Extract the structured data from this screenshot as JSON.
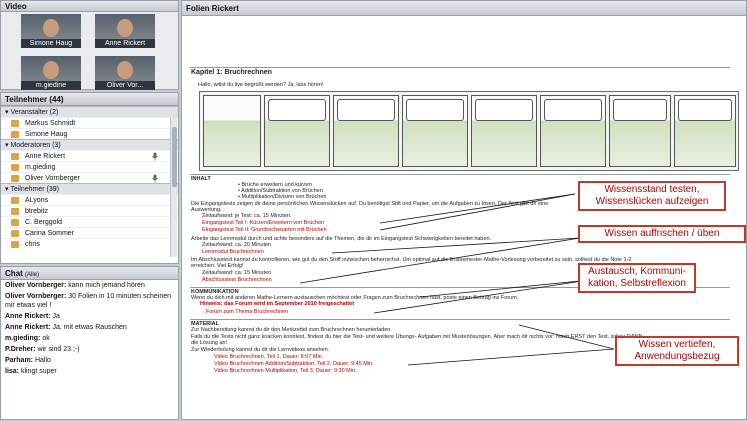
{
  "video": {
    "title": "Video",
    "tiles": [
      "Simone Haug",
      "Anne Rickert",
      "m.giedine",
      "Oliver Vor..."
    ]
  },
  "participants": {
    "title": "Teilnehmer",
    "count": "(44)",
    "groups": [
      {
        "label": "▾ Veranstalter (2)",
        "users": [
          "Markus Schmidt",
          "Simone Haug"
        ]
      },
      {
        "label": "▾ Moderatoren (3)",
        "users": [
          "Anne Rickert",
          "m.gieding",
          "Oliver Vornberger"
        ]
      },
      {
        "label": "▾ Teilnehmer (39)",
        "users": [
          "ALyons",
          "btrebitz",
          "C. Berggold",
          "Carina Sommer",
          "chris"
        ]
      }
    ]
  },
  "chat": {
    "title": "Chat",
    "scope": "(Alle)",
    "messages": [
      {
        "who": "Oliver Vornberger:",
        "text": " kann mich jemand hören"
      },
      {
        "who": "Oliver Vornberger:",
        "text": " 30 Folien in 10 minuten scheinen mir etwas viel !"
      },
      {
        "who": "Anne Rickert:",
        "text": " Ja"
      },
      {
        "who": "Anne Rickert:",
        "text": " Ja, mit etwas Rauschen"
      },
      {
        "who": "m.gieding:",
        "text": " ok"
      },
      {
        "who": "P.Dreher:",
        "text": " wir sind 23 ;-)"
      },
      {
        "who": "Parham:",
        "text": " Hallo"
      },
      {
        "who": "lisa:",
        "text": " klingt super"
      }
    ]
  },
  "slides": {
    "title": "Folien Rickert",
    "heading": "Kapitel 1: Bruchrechnen",
    "intro": "Hallo, willst du live begrüßt werden? Ja, lass hören!",
    "inhalt_label": "INHALT",
    "inhalt_items": [
      "Brüche erweitern und kürzen",
      "Addition/Subtraktion von Brüchen",
      "Multiplikation/Division von Brüchen"
    ],
    "eingangstest_text": "Die Eingangstests zeigen dir deine persönlichen Wissenslücken auf. Du benötigst Stift und Papier, um die Aufgaben zu lösen. Der Test gibt dir eine",
    "auswertung": "Auswertung.",
    "zeitaufwand1": "Zeitaufwand: je Test: ca. 15 Minuten.",
    "link_test1": "Eingangstest Teil I: Kürzen/Erweitern von Brüchen",
    "link_test2": "Eingangstest Teil II: Grundrechenarten mit Brüchen",
    "lernmodul_text": "Arbeite das Lernmodul durch und achte besonders auf die Themen, die dir im Eingangstest Schwierigkeiten bereitet haben.",
    "zeitaufwand2": "Zeitaufwand: ca. 20 Minuten",
    "link_lernmodul": "Lernmodul Bruchrechnen",
    "abschlusstest_text": "Im Abschlusstest kannst du kontrollieren, wie gut du den Stoff inzwischen beherrschst. Um optimal auf die Erstsemester-Mathe-Vorlesung vorbereitet zu sein, solltest du die Note 1-2",
    "abschlusstest_text2": "erreichen. Viel Erfolg!",
    "zeitaufwand3": "Zeitaufwand: ca. 15 Minuten",
    "link_abschlusstest": "Abschlusstest Bruchrechnen",
    "kommunikation_label": "KOMMUNIKATION",
    "kommunikation_text": "Wenn du dich mit anderen Mathe-Lernern austauschen möchtest oder Fragen zum Bruchrechnen hast, poste einen Beitrag ins Forum.",
    "hinweis": "Hinweis: das Forum wird im September 2010 freigeschaltet",
    "link_forum": "Forum zum Thema Bruchrechnen",
    "material_label": "MATERIAL",
    "material_text": "Zur Nachbereitung kannst du dir den Merkzettel zum Bruchrechnen herunterladen.",
    "material_text2": "Falls du die Tests nicht ganz knacken konntest, findest du hier die Test- und weitere Übungs- Aufgaben mit Musterlösungen. Aber mach dir nichts vor: mach ERST den Test, schau DANN",
    "material_text3": "die Lösung an!",
    "lernvideos_text": "Zur Wiederholung kannst du dir die Lernvideos ansehen.",
    "videos": [
      "Video Bruchrechnen, Teil 1, Dauer: 8:07 Min.",
      "Video Bruchrechnen Addition/Subtraktion, Teil 2, Dauer: 9:45 Min.",
      "Video Bruchrechnen Multiplikation, Teil 3, Dauer: 9:30 Min."
    ],
    "callouts": [
      "Wissensstand testen, Wissenslücken aufzeigen",
      "Wissen auffrischen / üben",
      "Austausch, Kommuni- kation, Selbstreflexion",
      "Wissen vertiefen, Anwendungsbezug"
    ]
  }
}
